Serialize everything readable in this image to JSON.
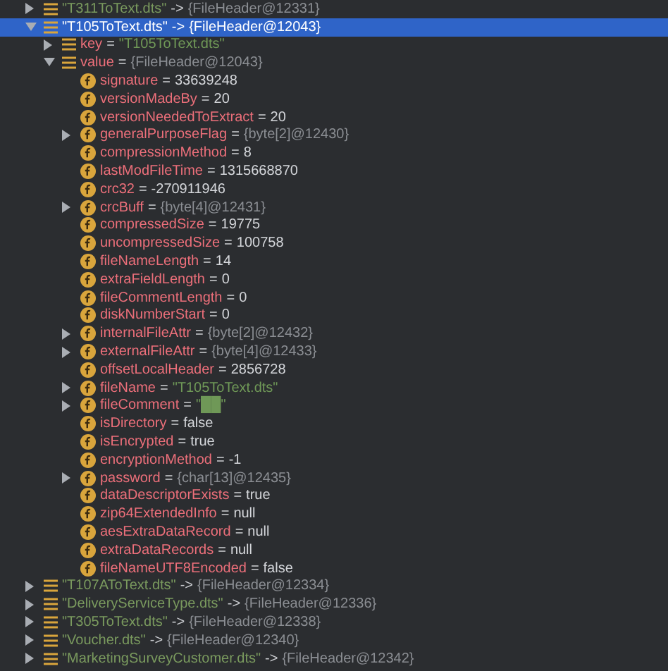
{
  "tree": [
    {
      "kind": "entry",
      "name": "\"T311ToText.dts\"",
      "op": "->",
      "value": {
        "kind": "ref",
        "text": "{FileHeader@12331}"
      },
      "expandable": true,
      "expanded": false,
      "selected": false
    },
    {
      "kind": "entry",
      "name": "\"T105ToText.dts\"",
      "op": "->",
      "value": {
        "kind": "ref",
        "text": "{FileHeader@12043}"
      },
      "expandable": true,
      "expanded": true,
      "selected": true,
      "children": [
        {
          "kind": "member",
          "name": "key",
          "op": "=",
          "value": {
            "kind": "string",
            "text": "\"T105ToText.dts\""
          },
          "expandable": true,
          "expanded": false,
          "selected": false
        },
        {
          "kind": "member",
          "name": "value",
          "op": "=",
          "value": {
            "kind": "ref",
            "text": "{FileHeader@12043}"
          },
          "expandable": true,
          "expanded": true,
          "selected": false,
          "children": [
            {
              "kind": "field",
              "name": "signature",
              "op": "=",
              "value": {
                "kind": "plain",
                "text": "33639248"
              },
              "expandable": false,
              "selected": false
            },
            {
              "kind": "field",
              "name": "versionMadeBy",
              "op": "=",
              "value": {
                "kind": "plain",
                "text": "20"
              },
              "expandable": false,
              "selected": false
            },
            {
              "kind": "field",
              "name": "versionNeededToExtract",
              "op": "=",
              "value": {
                "kind": "plain",
                "text": "20"
              },
              "expandable": false,
              "selected": false
            },
            {
              "kind": "field",
              "name": "generalPurposeFlag",
              "op": "=",
              "value": {
                "kind": "ref",
                "text": "{byte[2]@12430}"
              },
              "expandable": true,
              "expanded": false,
              "selected": false
            },
            {
              "kind": "field",
              "name": "compressionMethod",
              "op": "=",
              "value": {
                "kind": "plain",
                "text": "8"
              },
              "expandable": false,
              "selected": false
            },
            {
              "kind": "field",
              "name": "lastModFileTime",
              "op": "=",
              "value": {
                "kind": "plain",
                "text": "1315668870"
              },
              "expandable": false,
              "selected": false
            },
            {
              "kind": "field",
              "name": "crc32",
              "op": "=",
              "value": {
                "kind": "plain",
                "text": "-270911946"
              },
              "expandable": false,
              "selected": false
            },
            {
              "kind": "field",
              "name": "crcBuff",
              "op": "=",
              "value": {
                "kind": "ref",
                "text": "{byte[4]@12431}"
              },
              "expandable": true,
              "expanded": false,
              "selected": false
            },
            {
              "kind": "field",
              "name": "compressedSize",
              "op": "=",
              "value": {
                "kind": "plain",
                "text": "19775"
              },
              "expandable": false,
              "selected": false
            },
            {
              "kind": "field",
              "name": "uncompressedSize",
              "op": "=",
              "value": {
                "kind": "plain",
                "text": "100758"
              },
              "expandable": false,
              "selected": false
            },
            {
              "kind": "field",
              "name": "fileNameLength",
              "op": "=",
              "value": {
                "kind": "plain",
                "text": "14"
              },
              "expandable": false,
              "selected": false
            },
            {
              "kind": "field",
              "name": "extraFieldLength",
              "op": "=",
              "value": {
                "kind": "plain",
                "text": "0"
              },
              "expandable": false,
              "selected": false
            },
            {
              "kind": "field",
              "name": "fileCommentLength",
              "op": "=",
              "value": {
                "kind": "plain",
                "text": "0"
              },
              "expandable": false,
              "selected": false
            },
            {
              "kind": "field",
              "name": "diskNumberStart",
              "op": "=",
              "value": {
                "kind": "plain",
                "text": "0"
              },
              "expandable": false,
              "selected": false
            },
            {
              "kind": "field",
              "name": "internalFileAttr",
              "op": "=",
              "value": {
                "kind": "ref",
                "text": "{byte[2]@12432}"
              },
              "expandable": true,
              "expanded": false,
              "selected": false
            },
            {
              "kind": "field",
              "name": "externalFileAttr",
              "op": "=",
              "value": {
                "kind": "ref",
                "text": "{byte[4]@12433}"
              },
              "expandable": true,
              "expanded": false,
              "selected": false
            },
            {
              "kind": "field",
              "name": "offsetLocalHeader",
              "op": "=",
              "value": {
                "kind": "plain",
                "text": "2856728"
              },
              "expandable": false,
              "selected": false
            },
            {
              "kind": "field",
              "name": "fileName",
              "op": "=",
              "value": {
                "kind": "string",
                "text": "\"T105ToText.dts\""
              },
              "expandable": true,
              "expanded": false,
              "selected": false
            },
            {
              "kind": "field",
              "name": "fileComment",
              "op": "=",
              "value": {
                "kind": "string",
                "text": "\"██\""
              },
              "expandable": true,
              "expanded": false,
              "selected": false
            },
            {
              "kind": "field",
              "name": "isDirectory",
              "op": "=",
              "value": {
                "kind": "plain",
                "text": "false"
              },
              "expandable": false,
              "selected": false
            },
            {
              "kind": "field",
              "name": "isEncrypted",
              "op": "=",
              "value": {
                "kind": "plain",
                "text": "true"
              },
              "expandable": false,
              "selected": false
            },
            {
              "kind": "field",
              "name": "encryptionMethod",
              "op": "=",
              "value": {
                "kind": "plain",
                "text": "-1"
              },
              "expandable": false,
              "selected": false
            },
            {
              "kind": "field",
              "name": "password",
              "op": "=",
              "value": {
                "kind": "ref",
                "text": "{char[13]@12435}"
              },
              "expandable": true,
              "expanded": false,
              "selected": false
            },
            {
              "kind": "field",
              "name": "dataDescriptorExists",
              "op": "=",
              "value": {
                "kind": "plain",
                "text": "true"
              },
              "expandable": false,
              "selected": false
            },
            {
              "kind": "field",
              "name": "zip64ExtendedInfo",
              "op": "=",
              "value": {
                "kind": "plain",
                "text": "null"
              },
              "expandable": false,
              "selected": false
            },
            {
              "kind": "field",
              "name": "aesExtraDataRecord",
              "op": "=",
              "value": {
                "kind": "plain",
                "text": "null"
              },
              "expandable": false,
              "selected": false
            },
            {
              "kind": "field",
              "name": "extraDataRecords",
              "op": "=",
              "value": {
                "kind": "plain",
                "text": "null"
              },
              "expandable": false,
              "selected": false
            },
            {
              "kind": "field",
              "name": "fileNameUTF8Encoded",
              "op": "=",
              "value": {
                "kind": "plain",
                "text": "false"
              },
              "expandable": false,
              "selected": false
            }
          ]
        }
      ]
    },
    {
      "kind": "entry",
      "name": "\"T107AToText.dts\"",
      "op": "->",
      "value": {
        "kind": "ref",
        "text": "{FileHeader@12334}"
      },
      "expandable": true,
      "expanded": false,
      "selected": false
    },
    {
      "kind": "entry",
      "name": "\"DeliveryServiceType.dts\"",
      "op": "->",
      "value": {
        "kind": "ref",
        "text": "{FileHeader@12336}"
      },
      "expandable": true,
      "expanded": false,
      "selected": false
    },
    {
      "kind": "entry",
      "name": "\"T305ToText.dts\"",
      "op": "->",
      "value": {
        "kind": "ref",
        "text": "{FileHeader@12338}"
      },
      "expandable": true,
      "expanded": false,
      "selected": false
    },
    {
      "kind": "entry",
      "name": "\"Voucher.dts\"",
      "op": "->",
      "value": {
        "kind": "ref",
        "text": "{FileHeader@12340}"
      },
      "expandable": true,
      "expanded": false,
      "selected": false
    },
    {
      "kind": "entry",
      "name": "\"MarketingSurveyCustomer.dts\"",
      "op": "->",
      "value": {
        "kind": "ref",
        "text": "{FileHeader@12342}"
      },
      "expandable": true,
      "expanded": false,
      "selected": false
    }
  ]
}
